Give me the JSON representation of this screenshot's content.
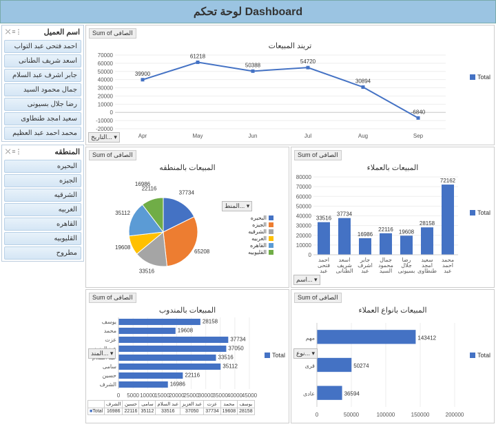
{
  "title": "لوحة تحكم Dashboard",
  "slicers": {
    "customer": {
      "header": "اسم العميل",
      "items": [
        "احمد فتحى عبد التواب",
        "اسعد شريف الطنانى",
        "جابر اشرف عبد السلام",
        "جمال محمود السيد",
        "رضا جلال بسيونى",
        "سعيد امجد طنطاوى",
        "محمد احمد عبد العظيم"
      ]
    },
    "region": {
      "header": "المنطقه",
      "items": [
        "البحيره",
        "الجيزه",
        "الشرقيه",
        "الغربيه",
        "القاهره",
        "القليوبيه",
        "مطروح"
      ]
    }
  },
  "sum_label": "Sum of الصافى",
  "legend_total": "Total",
  "dropdowns": {
    "date": "التاريخ...",
    "region": "المنط...",
    "rep": "المند...",
    "name": "اسم...",
    "type": "نوع..."
  },
  "chart_data": [
    {
      "id": "trend",
      "type": "line",
      "title": "تريند المبيعات",
      "categories": [
        "Apr",
        "May",
        "Jun",
        "Jul",
        "Aug",
        "Sep"
      ],
      "series": [
        {
          "name": "Total",
          "values": [
            39900,
            61218,
            50388,
            54720,
            30894,
            -6840
          ]
        }
      ],
      "ylim": [
        -20000,
        70000
      ],
      "yticks": [
        -20000,
        -10000,
        0,
        10000,
        20000,
        30000,
        40000,
        50000,
        60000,
        70000
      ]
    },
    {
      "id": "by_region",
      "type": "pie",
      "title": "المبيعات بالمنطقه",
      "categories": [
        "البحيره",
        "الجيزه",
        "الشرقيه",
        "الغربيه",
        "القاهره",
        "القليوبيه"
      ],
      "values": [
        37734,
        65208,
        33516,
        19608,
        35112,
        22116
      ],
      "colors": [
        "#4472c4",
        "#ed7d31",
        "#a5a5a5",
        "#ffc000",
        "#5b9bd5",
        "#70ad47"
      ],
      "extra_label": 16986
    },
    {
      "id": "by_customer",
      "type": "bar",
      "title": "المبيعات بالعملاء",
      "categories": [
        "احمد فتحى عبد التواب",
        "اسعد شريف الطنانى",
        "جابر اشرف عبد السلام",
        "جمال محمود السيد",
        "رضا جلال بسيونى",
        "سعيد امجد طنطاوى",
        "محمد احمد عبد العظيم"
      ],
      "series": [
        {
          "name": "Total",
          "values": [
            33516,
            37734,
            16986,
            22116,
            19608,
            28158,
            72162
          ]
        }
      ],
      "ylim": [
        0,
        80000
      ],
      "yticks": [
        0,
        10000,
        20000,
        30000,
        40000,
        50000,
        60000,
        70000,
        80000
      ]
    },
    {
      "id": "by_rep",
      "type": "bar_h",
      "title": "المبيعات بالمندوب",
      "categories": [
        "يوسف",
        "محمد",
        "عزت",
        "عبد العزيز",
        "عبد السلام",
        "سامى",
        "حسين",
        "الشرف"
      ],
      "series": [
        {
          "name": "Total",
          "values": [
            28158,
            19608,
            37734,
            37050,
            33516,
            35112,
            22116,
            16986
          ]
        }
      ],
      "xlim": [
        0,
        45000
      ],
      "xticks": [
        0,
        5000,
        10000,
        15000,
        20000,
        25000,
        30000,
        35000,
        40000,
        45000
      ],
      "table_values": [
        16986,
        22116,
        35112,
        33516,
        37050,
        37734,
        19608,
        28158
      ]
    },
    {
      "id": "by_type",
      "type": "bar_h",
      "title": "المبيعات بانواع العملاء",
      "categories": [
        "مهم",
        "قرى",
        "عادى"
      ],
      "series": [
        {
          "name": "Total",
          "values": [
            143412,
            50274,
            36594
          ]
        }
      ],
      "xlim": [
        0,
        200000
      ],
      "xticks": [
        0,
        50000,
        100000,
        150000,
        200000
      ]
    }
  ]
}
